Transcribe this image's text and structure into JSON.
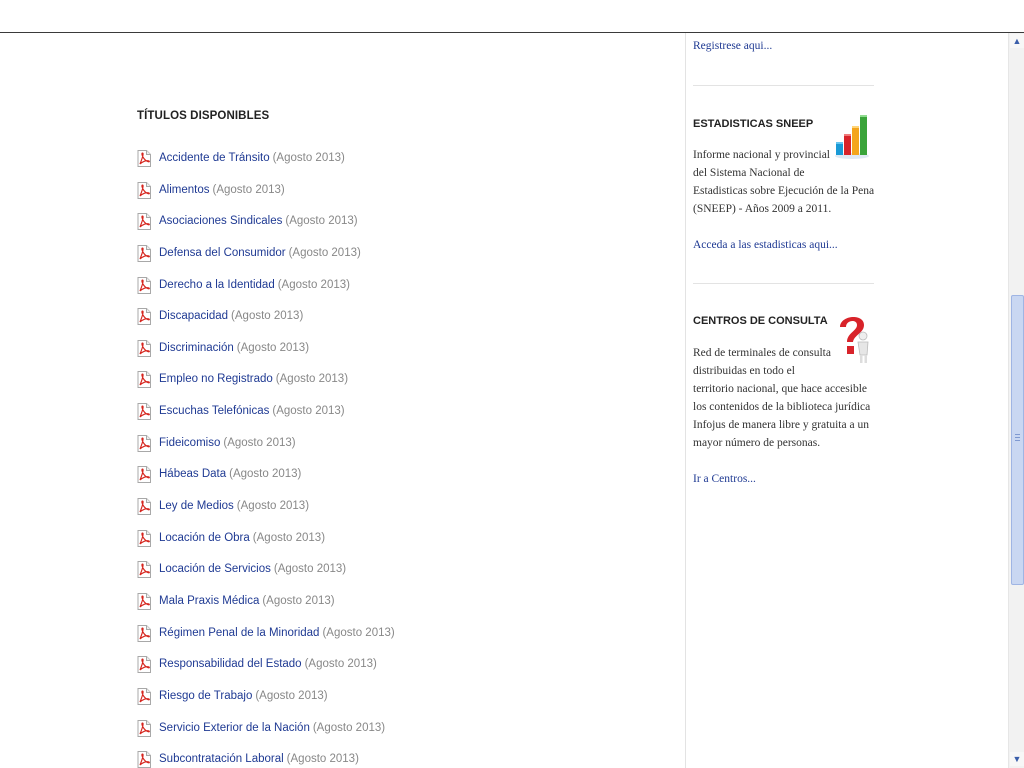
{
  "main": {
    "section_title": "TÍTULOS DISPONIBLES",
    "items": [
      {
        "title": "Accidente de Tránsito",
        "date": "(Agosto 2013)"
      },
      {
        "title": "Alimentos",
        "date": "(Agosto 2013)"
      },
      {
        "title": "Asociaciones Sindicales",
        "date": "(Agosto 2013)"
      },
      {
        "title": "Defensa del Consumidor",
        "date": "(Agosto 2013)"
      },
      {
        "title": "Derecho a la Identidad",
        "date": "(Agosto 2013)"
      },
      {
        "title": "Discapacidad",
        "date": "(Agosto 2013)"
      },
      {
        "title": "Discriminación",
        "date": "(Agosto 2013)"
      },
      {
        "title": "Empleo no Registrado",
        "date": "(Agosto 2013)"
      },
      {
        "title": "Escuchas Telefónicas",
        "date": "(Agosto 2013)"
      },
      {
        "title": "Fideicomiso",
        "date": "(Agosto 2013)"
      },
      {
        "title": "Hábeas Data",
        "date": "(Agosto 2013)"
      },
      {
        "title": "Ley de Medios",
        "date": "(Agosto 2013)"
      },
      {
        "title": "Locación de Obra",
        "date": "(Agosto 2013)"
      },
      {
        "title": "Locación de Servicios",
        "date": "(Agosto 2013)"
      },
      {
        "title": "Mala Praxis Médica",
        "date": "(Agosto 2013)"
      },
      {
        "title": "Régimen Penal de la Minoridad",
        "date": "(Agosto 2013)"
      },
      {
        "title": "Responsabilidad del Estado",
        "date": "(Agosto 2013)"
      },
      {
        "title": "Riesgo de Trabajo",
        "date": "(Agosto 2013)"
      },
      {
        "title": "Servicio Exterior de la Nación",
        "date": "(Agosto 2013)"
      },
      {
        "title": "Subcontratación Laboral",
        "date": "(Agosto 2013)"
      }
    ]
  },
  "sidebar": {
    "register_link": "Registrese aqui...",
    "stats": {
      "title": "ESTADISTICAS SNEEP",
      "text_lines": [
        "Informe nacional y provincial",
        "del Sistema Nacional de",
        "Estadisticas sobre Ejecución de la Pena",
        "(SNEEP) - Años 2009 a 2011."
      ],
      "link": "Acceda a las estadisticas aqui..."
    },
    "centers": {
      "title": "CENTROS DE CONSULTA",
      "text_lines": [
        "Red de terminales de consulta",
        "distribuidas en todo el",
        "territorio nacional, que hace accesible",
        "los contenidos de la biblioteca jurídica",
        "Infojus de manera libre y gratuita a un",
        "mayor número de personas."
      ],
      "link": "Ir a Centros..."
    }
  },
  "icons": {
    "pdf": "pdf-file-icon",
    "stats": "bar-chart-icon",
    "centers": "question-mark-person-icon"
  },
  "colors": {
    "link": "#1f3a93",
    "date": "#888888",
    "pdf_red": "#d6261f"
  }
}
